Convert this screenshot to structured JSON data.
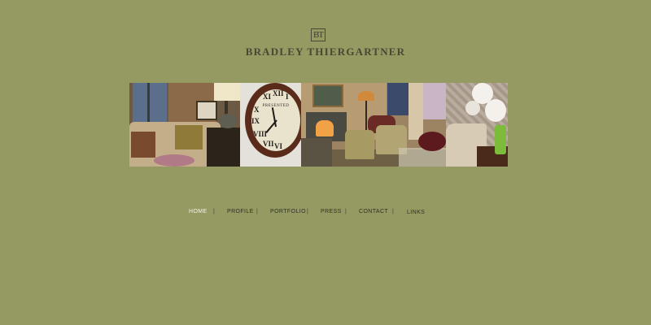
{
  "brand": {
    "monogram": "BT",
    "name": "BRADLEY THIERGARTNER"
  },
  "gallery": {
    "photos": [
      {
        "name": "living-room-photo"
      },
      {
        "name": "clock-photo",
        "clock_text": "PRESENTED",
        "numerals": [
          "XI",
          "XII",
          "I",
          "X",
          "IX",
          "VIII",
          "VII",
          "VI"
        ]
      },
      {
        "name": "fireplace-room-photo"
      },
      {
        "name": "orchid-photo"
      }
    ]
  },
  "nav": {
    "items": [
      "HOME",
      "PROFILE",
      "PORTFOLIO",
      "PRESS",
      "CONTACT",
      "LINKS"
    ],
    "separator": "|",
    "active": "HOME"
  },
  "colors": {
    "background": "#959a63",
    "nav_active": "#f5f3e6",
    "nav_text": "#2f3023"
  }
}
